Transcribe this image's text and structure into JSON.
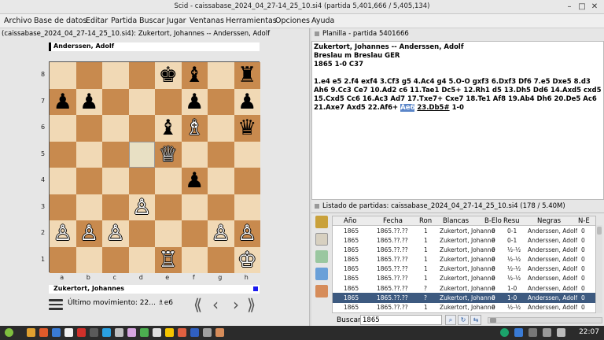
{
  "window": {
    "title": "Scid - caissabase_2024_04_27-14_25_10.si4 (partida 5,401,666 / 5,405,134)"
  },
  "menu": [
    "Archivo",
    "Base de datos",
    "Editar",
    "Partida",
    "Buscar",
    "Jugar",
    "Ventanas",
    "Herramientas",
    "Opciones",
    "Ayuda"
  ],
  "board_tab": "(caissabase_2024_04_27-14_25_10.si4): Zukertort, Johannes -- Anderssen, Adolf",
  "black_player": "Anderssen, Adolf",
  "white_player": "Zukertort, Johannes",
  "files": [
    "a",
    "b",
    "c",
    "d",
    "e",
    "f",
    "g",
    "h"
  ],
  "ranks": [
    "8",
    "7",
    "6",
    "5",
    "4",
    "3",
    "2",
    "1"
  ],
  "pieces": [
    {
      "sq": "e8",
      "p": "♚",
      "c": "b"
    },
    {
      "sq": "f8",
      "p": "♝",
      "c": "b"
    },
    {
      "sq": "h8",
      "p": "♜",
      "c": "b"
    },
    {
      "sq": "a7",
      "p": "♟",
      "c": "b"
    },
    {
      "sq": "b7",
      "p": "♟",
      "c": "b"
    },
    {
      "sq": "f7",
      "p": "♟",
      "c": "b"
    },
    {
      "sq": "h7",
      "p": "♟",
      "c": "b"
    },
    {
      "sq": "e6",
      "p": "♝",
      "c": "b"
    },
    {
      "sq": "f6",
      "p": "♗",
      "c": "w"
    },
    {
      "sq": "h6",
      "p": "♛",
      "c": "b"
    },
    {
      "sq": "e5",
      "p": "♕",
      "c": "w"
    },
    {
      "sq": "f4",
      "p": "♟",
      "c": "b"
    },
    {
      "sq": "d3",
      "p": "♙",
      "c": "w"
    },
    {
      "sq": "a2",
      "p": "♙",
      "c": "w"
    },
    {
      "sq": "b2",
      "p": "♙",
      "c": "w"
    },
    {
      "sq": "c2",
      "p": "♙",
      "c": "w"
    },
    {
      "sq": "g2",
      "p": "♙",
      "c": "w"
    },
    {
      "sq": "h2",
      "p": "♙",
      "c": "w"
    },
    {
      "sq": "e1",
      "p": "♖",
      "c": "w"
    },
    {
      "sq": "h1",
      "p": "♔",
      "c": "w"
    }
  ],
  "highlight_squares": [
    "d5"
  ],
  "last_move_text": "Último movimiento: 22... ♗e6",
  "nav": [
    "⟪",
    "‹",
    "›",
    "⟫"
  ],
  "planilla_tab": "Planilla - partida 5401666",
  "game_header": {
    "line1": "Zukertort, Johannes  --  Anderssen, Adolf",
    "line2": "Breslau m  Breslau GER",
    "line3": "1865  1-0  C37"
  },
  "moves_pre": "1.e4 e5 2.f4 exf4 3.Cf3 g5 4.Ac4 g4 5.O-O gxf3 6.Dxf3 Df6 7.e5 Dxe5 8.d3 Ah6 9.Cc3 Ce7 10.Ad2 c6 11.Tae1 Dc5+ 12.Rh1 d5 13.Dh5 Dd6 14.Axd5 cxd5 15.Cxd5 Cc6 16.Ac3 Ad7 17.Txe7+ Cxe7 18.Te1 Af8 19.Ab4 Dh6 20.De5 Ac6 21.Axe7 Axd5 22.Af6+",
  "moves_current": "Ae6",
  "moves_next": "23.Db5#",
  "moves_result": "1-0",
  "list_tab": "Listado de partidas: caissabase_2024_04_27-14_25_10.si4 (178 / 5.40M)",
  "columns": [
    "Año",
    "Fecha",
    "Ron",
    "Blancas",
    "B-Elo",
    "Resu",
    "Negras",
    "N-E"
  ],
  "rows": [
    [
      "1865",
      "1865.??.??",
      "1",
      "Zukertort, Johanne",
      "0",
      "0-1",
      "Anderssen, Adolf",
      "0"
    ],
    [
      "1865",
      "1865.??.??",
      "1",
      "Zukertort, Johanne",
      "0",
      "0-1",
      "Anderssen, Adolf",
      "0"
    ],
    [
      "1865",
      "1865.??.??",
      "1",
      "Zukertort, Johanne",
      "0",
      "½-½",
      "Anderssen, Adolf",
      "0"
    ],
    [
      "1865",
      "1865.??.??",
      "1",
      "Zukertort, Johanne",
      "0",
      "½-½",
      "Anderssen, Adolf",
      "0"
    ],
    [
      "1865",
      "1865.??.??",
      "1",
      "Zukertort, Johanne",
      "0",
      "½-½",
      "Anderssen, Adolf",
      "0"
    ],
    [
      "1865",
      "1865.??.??",
      "1",
      "Zukertort, Johanne",
      "0",
      "½-½",
      "Anderssen, Adolf",
      "0"
    ],
    [
      "1865",
      "1865.??.??",
      "?",
      "Zukertort, Johanne",
      "0",
      "1-0",
      "Anderssen, Adolf",
      "0"
    ],
    [
      "1865",
      "1865.??.??",
      "?",
      "Zukertort, Johanne",
      "0",
      "1-0",
      "Anderssen, Adolf",
      "0"
    ],
    [
      "1865",
      "1865.??.??",
      "1",
      "Zukertort, Johanne",
      "0",
      "½-½",
      "Anderssen, Adolf",
      "0"
    ],
    [
      "1865",
      "1865.??.??",
      "1",
      "Zukertort, Johanne",
      "0",
      "1-0",
      "Anderssen, Adolf",
      "0"
    ],
    [
      "1865",
      "1865.??.??",
      "1",
      "Zukertort, Johanne",
      "0",
      "1-0",
      "Anderssen, Adolf",
      "0"
    ]
  ],
  "selected_row": 7,
  "search": {
    "label": "Buscar",
    "value": "1865"
  },
  "clock": "22:07",
  "colors": {
    "light_square": "#f1d9b5",
    "dark_square": "#c88a4e",
    "selection": "#3d5a80",
    "current_move": "#5b86c9"
  }
}
